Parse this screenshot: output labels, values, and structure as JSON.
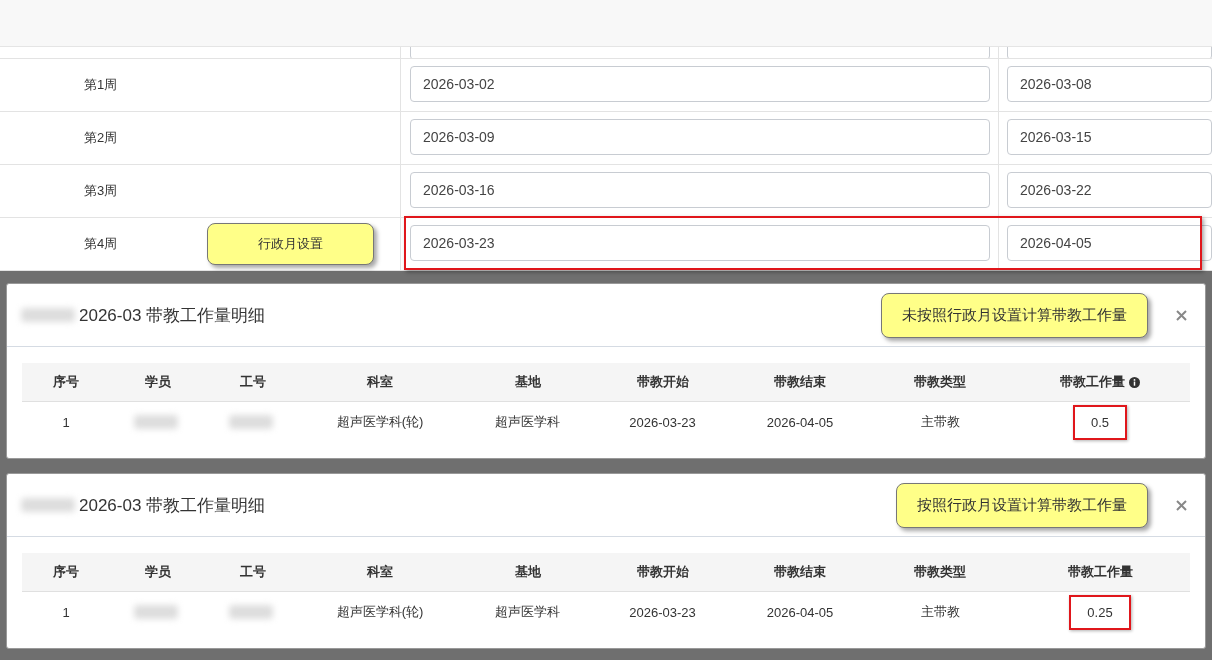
{
  "week_table": {
    "rows": [
      {
        "label": "第1周",
        "start": "2026-03-02",
        "end": "2026-03-08",
        "highlighted": false
      },
      {
        "label": "第2周",
        "start": "2026-03-09",
        "end": "2026-03-15",
        "highlighted": false
      },
      {
        "label": "第3周",
        "start": "2026-03-16",
        "end": "2026-03-22",
        "highlighted": false
      },
      {
        "label": "第4周",
        "start": "2026-03-23",
        "end": "2026-04-05",
        "highlighted": true
      }
    ]
  },
  "callout": "行政月设置",
  "dialogs": [
    {
      "title": "2026-03 带教工作量明细",
      "note": "未按照行政月设置计算带教工作量",
      "columns": [
        {
          "label": "序号",
          "info": false
        },
        {
          "label": "学员",
          "info": false
        },
        {
          "label": "工号",
          "info": false
        },
        {
          "label": "科室",
          "info": false
        },
        {
          "label": "基地",
          "info": false
        },
        {
          "label": "带教开始",
          "info": false
        },
        {
          "label": "带教结束",
          "info": false
        },
        {
          "label": "带教类型",
          "info": false
        },
        {
          "label": "带教工作量",
          "info": true
        }
      ],
      "rows": [
        {
          "cells": [
            {
              "kind": "text",
              "text": "1",
              "highlighted": false
            },
            {
              "kind": "blurred"
            },
            {
              "kind": "blurred"
            },
            {
              "kind": "text",
              "text": "超声医学科(轮)",
              "highlighted": false
            },
            {
              "kind": "text",
              "text": "超声医学科",
              "highlighted": false
            },
            {
              "kind": "text",
              "text": "2026-03-23",
              "highlighted": false
            },
            {
              "kind": "text",
              "text": "2026-04-05",
              "highlighted": false
            },
            {
              "kind": "text",
              "text": "主带教",
              "highlighted": false
            },
            {
              "kind": "text",
              "text": "0.5",
              "highlighted": true
            }
          ]
        }
      ]
    },
    {
      "title": "2026-03 带教工作量明细",
      "note": "按照行政月设置计算带教工作量",
      "columns": [
        {
          "label": "序号",
          "info": false
        },
        {
          "label": "学员",
          "info": false
        },
        {
          "label": "工号",
          "info": false
        },
        {
          "label": "科室",
          "info": false
        },
        {
          "label": "基地",
          "info": false
        },
        {
          "label": "带教开始",
          "info": false
        },
        {
          "label": "带教结束",
          "info": false
        },
        {
          "label": "带教类型",
          "info": false
        },
        {
          "label": "带教工作量",
          "info": false
        }
      ],
      "rows": [
        {
          "cells": [
            {
              "kind": "text",
              "text": "1",
              "highlighted": false
            },
            {
              "kind": "blurred"
            },
            {
              "kind": "blurred"
            },
            {
              "kind": "text",
              "text": "超声医学科(轮)",
              "highlighted": false
            },
            {
              "kind": "text",
              "text": "超声医学科",
              "highlighted": false
            },
            {
              "kind": "text",
              "text": "2026-03-23",
              "highlighted": false
            },
            {
              "kind": "text",
              "text": "2026-04-05",
              "highlighted": false
            },
            {
              "kind": "text",
              "text": "主带教",
              "highlighted": false
            },
            {
              "kind": "text",
              "text": "0.25",
              "highlighted": true
            }
          ]
        }
      ]
    }
  ]
}
